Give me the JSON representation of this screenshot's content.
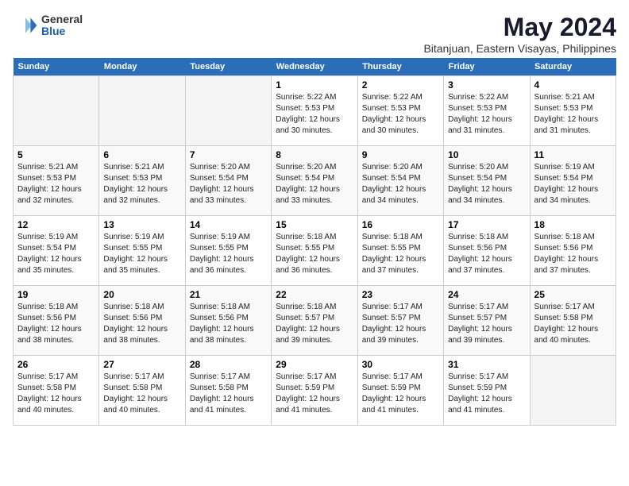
{
  "logo": {
    "general": "General",
    "blue": "Blue"
  },
  "title": "May 2024",
  "subtitle": "Bitanjuan, Eastern Visayas, Philippines",
  "headers": [
    "Sunday",
    "Monday",
    "Tuesday",
    "Wednesday",
    "Thursday",
    "Friday",
    "Saturday"
  ],
  "weeks": [
    [
      {
        "day": "",
        "lines": []
      },
      {
        "day": "",
        "lines": []
      },
      {
        "day": "",
        "lines": []
      },
      {
        "day": "1",
        "lines": [
          "Sunrise: 5:22 AM",
          "Sunset: 5:53 PM",
          "Daylight: 12 hours",
          "and 30 minutes."
        ]
      },
      {
        "day": "2",
        "lines": [
          "Sunrise: 5:22 AM",
          "Sunset: 5:53 PM",
          "Daylight: 12 hours",
          "and 30 minutes."
        ]
      },
      {
        "day": "3",
        "lines": [
          "Sunrise: 5:22 AM",
          "Sunset: 5:53 PM",
          "Daylight: 12 hours",
          "and 31 minutes."
        ]
      },
      {
        "day": "4",
        "lines": [
          "Sunrise: 5:21 AM",
          "Sunset: 5:53 PM",
          "Daylight: 12 hours",
          "and 31 minutes."
        ]
      }
    ],
    [
      {
        "day": "5",
        "lines": [
          "Sunrise: 5:21 AM",
          "Sunset: 5:53 PM",
          "Daylight: 12 hours",
          "and 32 minutes."
        ]
      },
      {
        "day": "6",
        "lines": [
          "Sunrise: 5:21 AM",
          "Sunset: 5:53 PM",
          "Daylight: 12 hours",
          "and 32 minutes."
        ]
      },
      {
        "day": "7",
        "lines": [
          "Sunrise: 5:20 AM",
          "Sunset: 5:54 PM",
          "Daylight: 12 hours",
          "and 33 minutes."
        ]
      },
      {
        "day": "8",
        "lines": [
          "Sunrise: 5:20 AM",
          "Sunset: 5:54 PM",
          "Daylight: 12 hours",
          "and 33 minutes."
        ]
      },
      {
        "day": "9",
        "lines": [
          "Sunrise: 5:20 AM",
          "Sunset: 5:54 PM",
          "Daylight: 12 hours",
          "and 34 minutes."
        ]
      },
      {
        "day": "10",
        "lines": [
          "Sunrise: 5:20 AM",
          "Sunset: 5:54 PM",
          "Daylight: 12 hours",
          "and 34 minutes."
        ]
      },
      {
        "day": "11",
        "lines": [
          "Sunrise: 5:19 AM",
          "Sunset: 5:54 PM",
          "Daylight: 12 hours",
          "and 34 minutes."
        ]
      }
    ],
    [
      {
        "day": "12",
        "lines": [
          "Sunrise: 5:19 AM",
          "Sunset: 5:54 PM",
          "Daylight: 12 hours",
          "and 35 minutes."
        ]
      },
      {
        "day": "13",
        "lines": [
          "Sunrise: 5:19 AM",
          "Sunset: 5:55 PM",
          "Daylight: 12 hours",
          "and 35 minutes."
        ]
      },
      {
        "day": "14",
        "lines": [
          "Sunrise: 5:19 AM",
          "Sunset: 5:55 PM",
          "Daylight: 12 hours",
          "and 36 minutes."
        ]
      },
      {
        "day": "15",
        "lines": [
          "Sunrise: 5:18 AM",
          "Sunset: 5:55 PM",
          "Daylight: 12 hours",
          "and 36 minutes."
        ]
      },
      {
        "day": "16",
        "lines": [
          "Sunrise: 5:18 AM",
          "Sunset: 5:55 PM",
          "Daylight: 12 hours",
          "and 37 minutes."
        ]
      },
      {
        "day": "17",
        "lines": [
          "Sunrise: 5:18 AM",
          "Sunset: 5:56 PM",
          "Daylight: 12 hours",
          "and 37 minutes."
        ]
      },
      {
        "day": "18",
        "lines": [
          "Sunrise: 5:18 AM",
          "Sunset: 5:56 PM",
          "Daylight: 12 hours",
          "and 37 minutes."
        ]
      }
    ],
    [
      {
        "day": "19",
        "lines": [
          "Sunrise: 5:18 AM",
          "Sunset: 5:56 PM",
          "Daylight: 12 hours",
          "and 38 minutes."
        ]
      },
      {
        "day": "20",
        "lines": [
          "Sunrise: 5:18 AM",
          "Sunset: 5:56 PM",
          "Daylight: 12 hours",
          "and 38 minutes."
        ]
      },
      {
        "day": "21",
        "lines": [
          "Sunrise: 5:18 AM",
          "Sunset: 5:56 PM",
          "Daylight: 12 hours",
          "and 38 minutes."
        ]
      },
      {
        "day": "22",
        "lines": [
          "Sunrise: 5:18 AM",
          "Sunset: 5:57 PM",
          "Daylight: 12 hours",
          "and 39 minutes."
        ]
      },
      {
        "day": "23",
        "lines": [
          "Sunrise: 5:17 AM",
          "Sunset: 5:57 PM",
          "Daylight: 12 hours",
          "and 39 minutes."
        ]
      },
      {
        "day": "24",
        "lines": [
          "Sunrise: 5:17 AM",
          "Sunset: 5:57 PM",
          "Daylight: 12 hours",
          "and 39 minutes."
        ]
      },
      {
        "day": "25",
        "lines": [
          "Sunrise: 5:17 AM",
          "Sunset: 5:58 PM",
          "Daylight: 12 hours",
          "and 40 minutes."
        ]
      }
    ],
    [
      {
        "day": "26",
        "lines": [
          "Sunrise: 5:17 AM",
          "Sunset: 5:58 PM",
          "Daylight: 12 hours",
          "and 40 minutes."
        ]
      },
      {
        "day": "27",
        "lines": [
          "Sunrise: 5:17 AM",
          "Sunset: 5:58 PM",
          "Daylight: 12 hours",
          "and 40 minutes."
        ]
      },
      {
        "day": "28",
        "lines": [
          "Sunrise: 5:17 AM",
          "Sunset: 5:58 PM",
          "Daylight: 12 hours",
          "and 41 minutes."
        ]
      },
      {
        "day": "29",
        "lines": [
          "Sunrise: 5:17 AM",
          "Sunset: 5:59 PM",
          "Daylight: 12 hours",
          "and 41 minutes."
        ]
      },
      {
        "day": "30",
        "lines": [
          "Sunrise: 5:17 AM",
          "Sunset: 5:59 PM",
          "Daylight: 12 hours",
          "and 41 minutes."
        ]
      },
      {
        "day": "31",
        "lines": [
          "Sunrise: 5:17 AM",
          "Sunset: 5:59 PM",
          "Daylight: 12 hours",
          "and 41 minutes."
        ]
      },
      {
        "day": "",
        "lines": []
      }
    ]
  ]
}
